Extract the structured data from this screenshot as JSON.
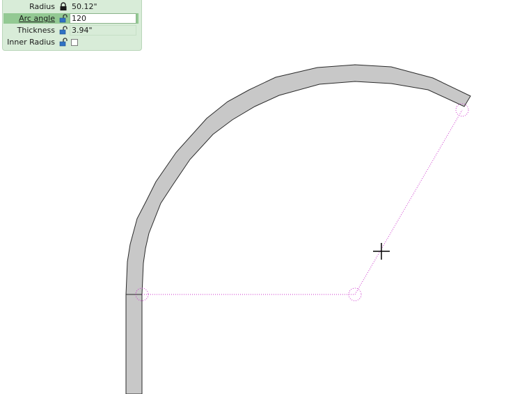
{
  "properties": {
    "radius": {
      "label": "Radius",
      "value": "50.12\"",
      "lock": "locked-padlock-icon"
    },
    "arc_angle": {
      "label": "Arc angle",
      "value": "120",
      "lock": "unlocked-padlock-icon"
    },
    "thickness": {
      "label": "Thickness",
      "value": "3.94\"",
      "lock": "unlocked-padlock-icon"
    },
    "inner_radius": {
      "label": "Inner Radius",
      "checked": false,
      "lock": "unlocked-padlock-icon"
    }
  },
  "colors": {
    "panel_bg": "#d8ecd8",
    "active_row": "#93c993",
    "wall_fill": "#c8c8c8",
    "wall_stroke": "#2a2a2a",
    "guide": "#cc33cc"
  }
}
